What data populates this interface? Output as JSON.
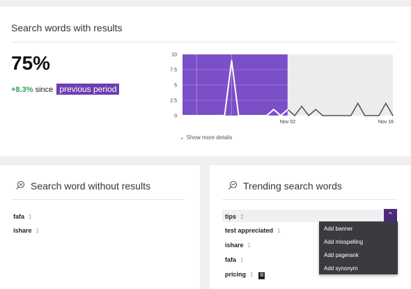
{
  "top_card": {
    "title": "Search words with results",
    "big_number": "75%",
    "delta_value": "+8.3%",
    "delta_since": "since",
    "delta_period": "previous period",
    "show_more": "Show more details"
  },
  "chart_data": {
    "type": "line",
    "yticks": [
      "10",
      "7.5",
      "5",
      "2.5",
      "0"
    ],
    "ylim": [
      0,
      10
    ],
    "xticks": [
      "Nov 02",
      "Nov 16"
    ],
    "highlight_color": "#7b4fc7",
    "line_color_highlight": "#ffffff",
    "line_color_normal": "#555555",
    "series": [
      {
        "x": [
          0,
          1,
          2,
          3,
          4,
          5,
          6,
          7,
          8,
          9,
          10,
          11,
          12,
          13,
          14,
          15,
          16,
          17,
          18,
          19,
          20,
          21,
          22,
          23,
          24,
          25,
          26,
          27,
          28,
          29,
          30
        ],
        "values": [
          0,
          0,
          0,
          0,
          0,
          0,
          0,
          9,
          0,
          0,
          0,
          0,
          0,
          1,
          0,
          1,
          0,
          1.5,
          0,
          1,
          0,
          0,
          0,
          0,
          0,
          2,
          0,
          0,
          0,
          2,
          0
        ]
      }
    ],
    "highlight_end_index": 15,
    "grid": true
  },
  "left_card": {
    "title": "Search word without results",
    "icon": "search-cancel-icon",
    "words": [
      {
        "word": "fafa",
        "count": "1"
      },
      {
        "word": "ishare",
        "count": "1"
      }
    ]
  },
  "right_card": {
    "title": "Trending search words",
    "icon": "search-trend-icon",
    "words": [
      {
        "word": "tips",
        "count": "2"
      },
      {
        "word": "test appreciated",
        "count": "1"
      },
      {
        "word": "ishare",
        "count": "1"
      },
      {
        "word": "fafa",
        "count": "1"
      },
      {
        "word": "pricing",
        "count": "1"
      }
    ],
    "toggle_icon": "chevron-up-icon",
    "menu": [
      "Add banner",
      "Add misspelling",
      "Add pagerank",
      "Add synonym"
    ],
    "pricing_badge": "B"
  }
}
